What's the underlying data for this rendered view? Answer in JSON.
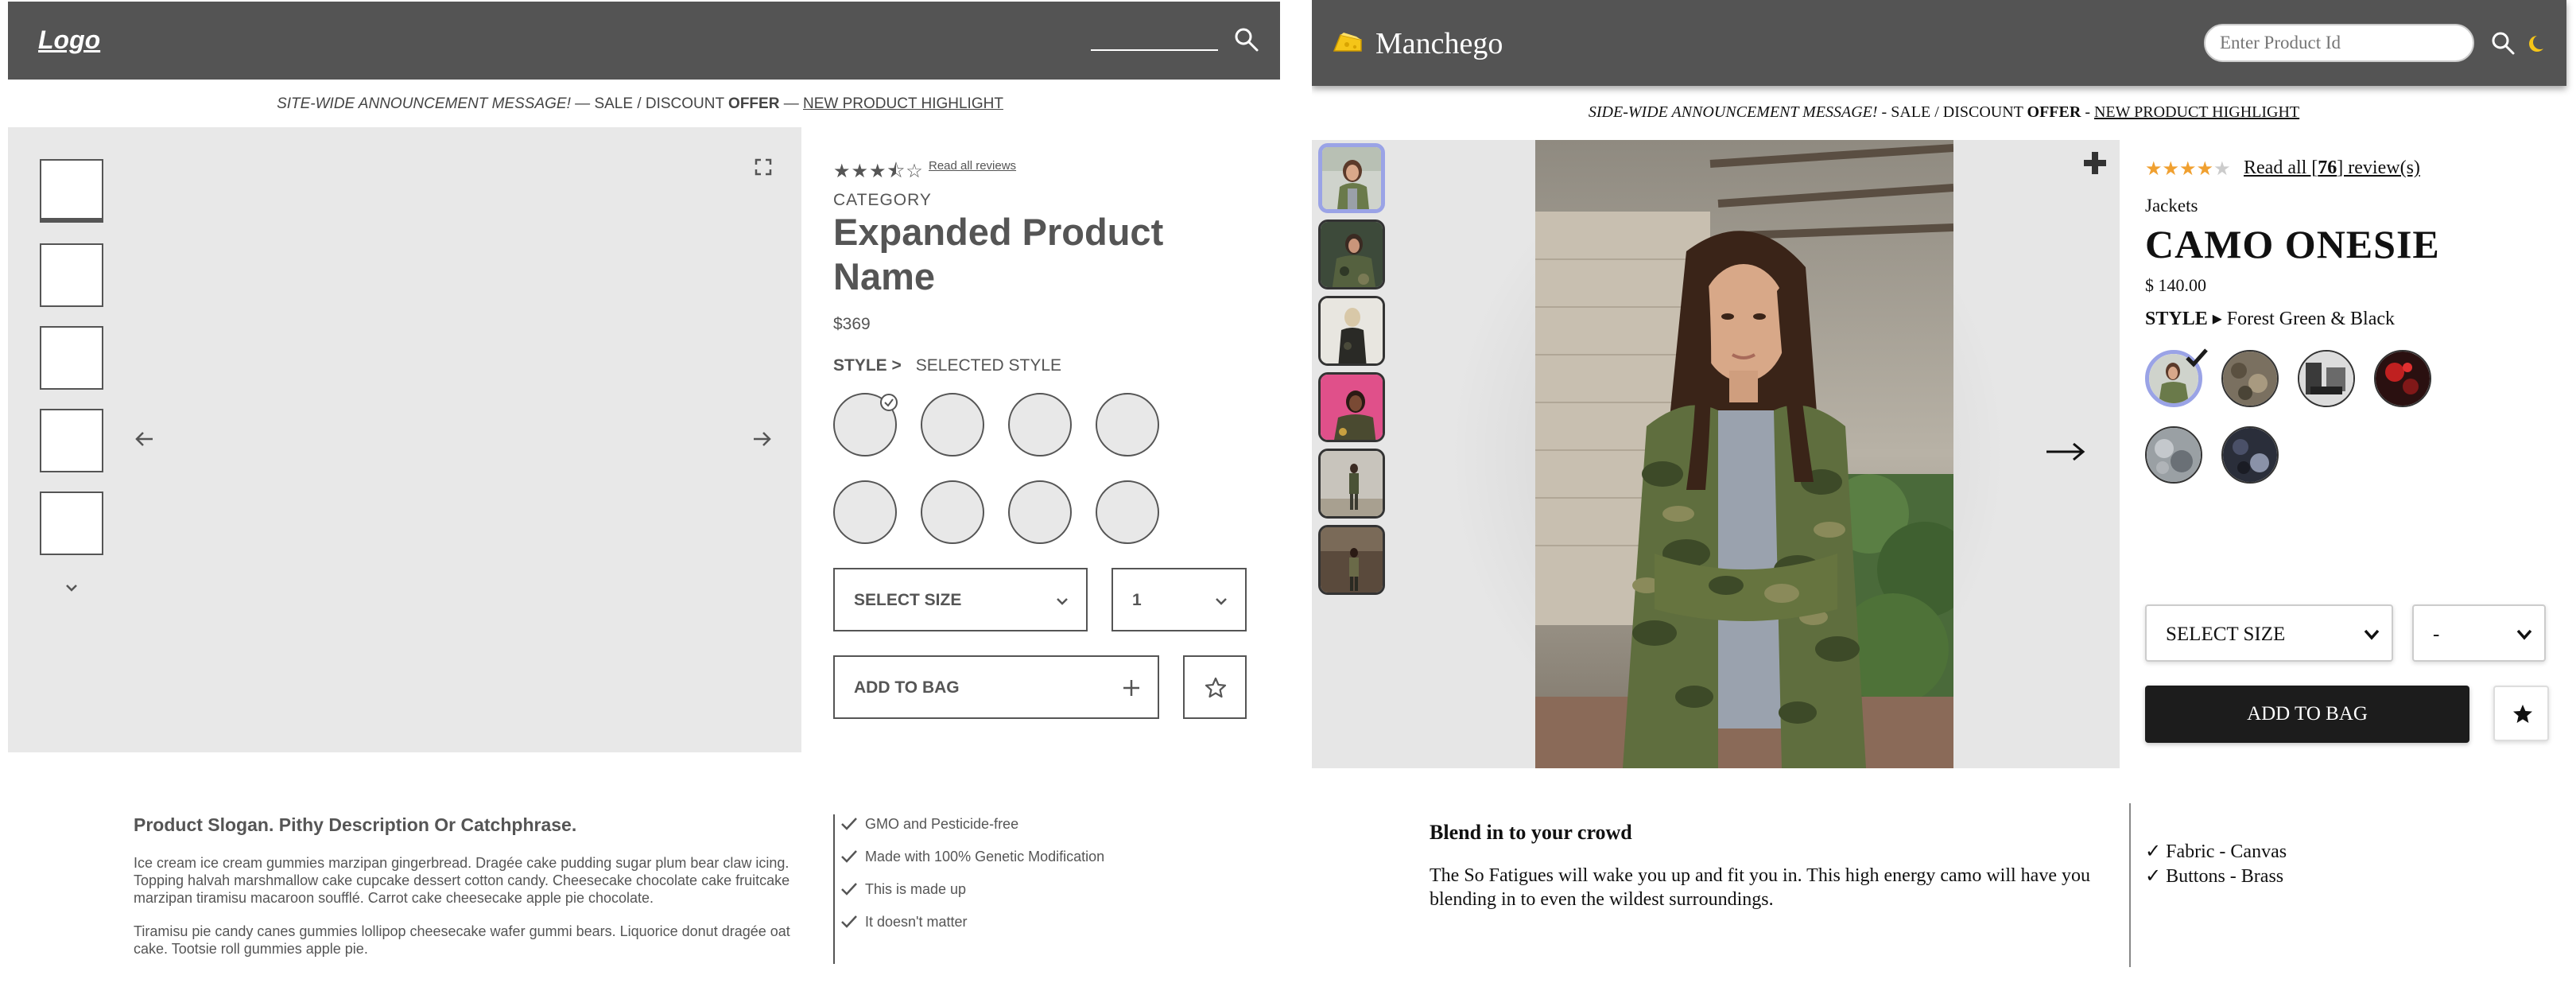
{
  "wireframe": {
    "logo": "Logo",
    "announcement": {
      "message": "SITE-WIDE ANNOUNCEMENT MESSAGE!",
      "sep1": "—",
      "sale": "SALE / DISCOUNT",
      "offer": "OFFER",
      "sep2": "—",
      "highlight": "NEW PRODUCT HIGHLIGHT"
    },
    "rating_stars": "★★★⯪☆",
    "rating": 3.5,
    "read_all": "Read all reviews",
    "category": "CATEGORY",
    "product_name": "Expanded Product Name",
    "price": "$369",
    "style_label": "STYLE >",
    "selected_style": "SELECTED STYLE",
    "size_label": "SELECT SIZE",
    "qty_label": "1",
    "add_to_bag": "ADD TO BAG",
    "slogan": "Product Slogan. Pithy Description Or Catchphrase.",
    "description_1": "Ice cream ice cream gummies marzipan gingerbread. Dragée cake pudding sugar plum bear claw icing. Topping halvah marshmallow cake cupcake dessert cotton candy. Cheesecake chocolate cake fruitcake marzipan tiramisu macaroon soufflé. Carrot cake cheesecake apple pie chocolate.",
    "description_2": "Tiramisu pie candy canes gummies lollipop cheesecake wafer gummi bears. Liquorice donut dragée oat cake. Tootsie roll gummies apple pie.",
    "features": [
      "GMO and Pesticide-free",
      "Made with 100% Genetic Modification",
      "This is made up",
      "It doesn't matter"
    ]
  },
  "manchego": {
    "brand": "Manchego",
    "search_placeholder": "Enter Product Id",
    "announcement": {
      "message": "SIDE-WIDE ANNOUNCEMENT MESSAGE!",
      "sep1": "-",
      "sale": "SALE / DISCOUNT",
      "offer": "OFFER",
      "sep2": "-",
      "highlight": "NEW PRODUCT HIGHLIGHT"
    },
    "rating_filled": "★★★★",
    "rating_empty": "★",
    "rating": 4,
    "read_all_prefix": "Read all [",
    "review_count": "76",
    "read_all_suffix": "] review(s)",
    "category": "Jackets",
    "product_name": "CAMO ONESIE",
    "price": "$ 140.00",
    "style_label": "STYLE",
    "style_arrow": "▸",
    "selected_style": "Forest Green & Black",
    "size_label": "SELECT SIZE",
    "qty_label": "-",
    "add_to_bag": "ADD TO BAG",
    "slogan": "Blend in to your crowd",
    "description": "The So Fatigues will wake you up and fit you in. This high energy camo will have you blending in to even the wildest surroundings.",
    "features": [
      "✓ Fabric - Canvas",
      "✓ Buttons - Brass"
    ],
    "colors": {
      "header": "#545454",
      "star": "#f0a030",
      "selected_ring": "#9aa3e6"
    }
  }
}
